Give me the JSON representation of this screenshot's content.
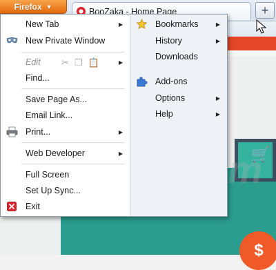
{
  "browser": {
    "app_button_label": "Firefox",
    "tab_title": "BooZaka - Home Page",
    "new_tab_symbol": "+"
  },
  "page": {
    "watermark": "risk.com",
    "coin_symbol": "$",
    "cart_symbol": "🛒"
  },
  "menu": {
    "left": {
      "new_tab": "New Tab",
      "new_private_window": "New Private Window",
      "edit": "Edit",
      "find": "Find...",
      "save_page_as": "Save Page As...",
      "email_link": "Email Link...",
      "print": "Print...",
      "web_developer": "Web Developer",
      "full_screen": "Full Screen",
      "set_up_sync": "Set Up Sync...",
      "exit": "Exit"
    },
    "right": {
      "bookmarks": "Bookmarks",
      "history": "History",
      "downloads": "Downloads",
      "addons": "Add-ons",
      "options": "Options",
      "help": "Help"
    },
    "submenu_arrow": "▶"
  },
  "colors": {
    "firefox_orange": "#e66a0b",
    "exit_red": "#d9262e",
    "addons_blue": "#3b7bd6",
    "bookmark_star": "#f2c230"
  }
}
